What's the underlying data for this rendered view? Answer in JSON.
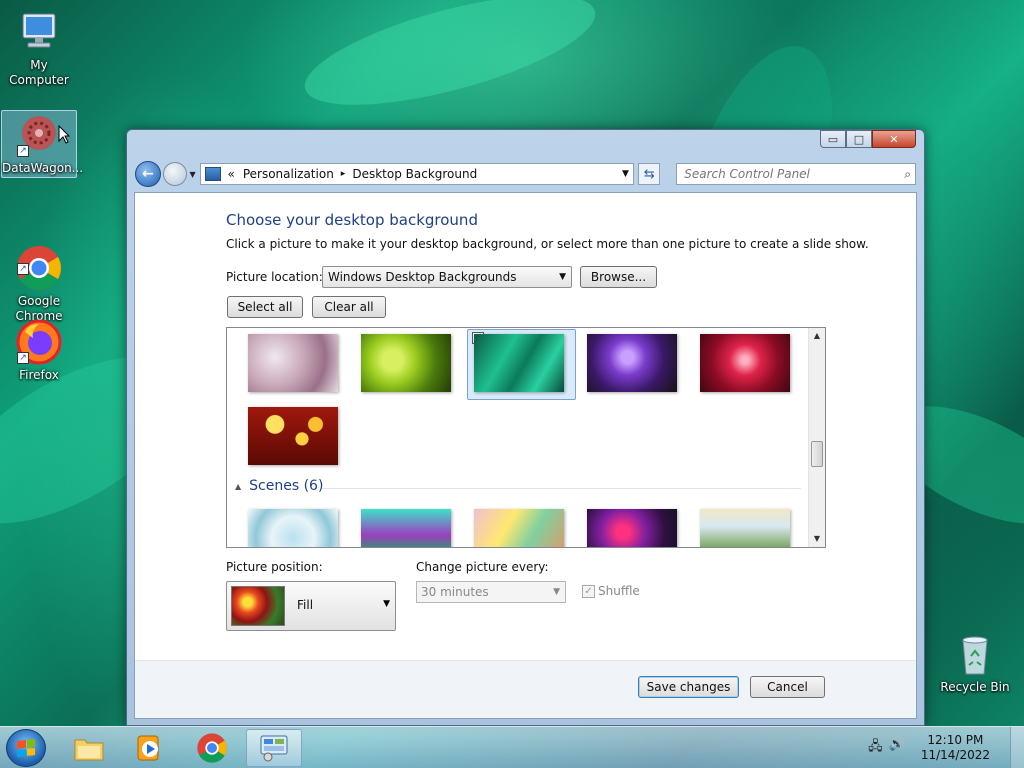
{
  "desktop": {
    "icons": [
      {
        "label": "My Computer"
      },
      {
        "label": "DataWagon..."
      },
      {
        "label": "Google\nChrome"
      },
      {
        "label": "Firefox"
      },
      {
        "label": "Recycle Bin"
      }
    ]
  },
  "window": {
    "caption_buttons": {
      "minimize": "▭",
      "maximize": "□",
      "close": "✕"
    },
    "address": {
      "prefix": "«",
      "crumbs": [
        "Personalization",
        "Desktop Background"
      ],
      "separator": "▸"
    },
    "search": {
      "placeholder": "Search Control Panel"
    },
    "content": {
      "heading": "Choose your desktop background",
      "subtext": "Click a picture to make it your desktop background, or select more than one picture to create a slide show.",
      "picture_location_label": "Picture location:",
      "picture_location_value": "Windows Desktop Backgrounds",
      "browse_label": "Browse...",
      "select_all_label": "Select all",
      "clear_all_label": "Clear all",
      "gallery": {
        "selected_check": "✓",
        "group_header": "Scenes (6)"
      },
      "picture_position_label": "Picture position:",
      "picture_position_value": "Fill",
      "change_every_label": "Change picture every:",
      "change_every_value": "30 minutes",
      "shuffle_label": "Shuffle",
      "shuffle_check": "✓"
    },
    "footer": {
      "save_label": "Save changes",
      "cancel_label": "Cancel"
    }
  },
  "taskbar": {
    "clock_time": "12:10 PM",
    "clock_date": "11/14/2022"
  },
  "colors": {
    "heading": "#1e3f8a",
    "accent": "#1c5ab5"
  }
}
